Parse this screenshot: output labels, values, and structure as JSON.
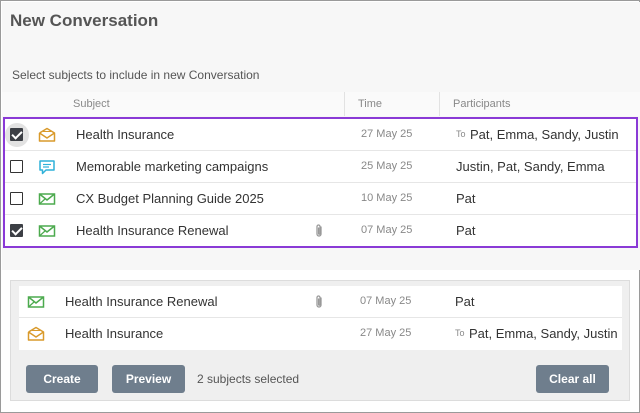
{
  "dialog": {
    "title": "New Conversation",
    "instruction": "Select subjects to include in new Conversation"
  },
  "columns": {
    "subject": "Subject",
    "time": "Time",
    "participants": "Participants"
  },
  "rows": [
    {
      "checked": true,
      "icon": "envelope-open-icon",
      "icon_color": "#d99a2b",
      "subject": "Health Insurance",
      "attachment": false,
      "time": "27 May 25",
      "to_prefix": "To",
      "participants": "Pat, Emma, Sandy, Justin"
    },
    {
      "checked": false,
      "icon": "chat-bubble-icon",
      "icon_color": "#2fb1d9",
      "subject": "Memorable marketing campaigns",
      "attachment": false,
      "time": "25 May 25",
      "to_prefix": "",
      "participants": "Justin, Pat, Sandy, Emma"
    },
    {
      "checked": false,
      "icon": "envelope-icon",
      "icon_color": "#4caa4e",
      "subject": "CX Budget Planning Guide 2025",
      "attachment": false,
      "time": "10 May 25",
      "to_prefix": "",
      "participants": "Pat"
    },
    {
      "checked": true,
      "icon": "envelope-icon",
      "icon_color": "#4caa4e",
      "subject": "Health Insurance Renewal",
      "attachment": true,
      "time": "07 May 25",
      "to_prefix": "",
      "participants": "Pat"
    }
  ],
  "selected": [
    {
      "icon": "envelope-icon",
      "icon_color": "#4caa4e",
      "subject": "Health Insurance Renewal",
      "attachment": true,
      "time": "07 May 25",
      "to_prefix": "",
      "participants": "Pat"
    },
    {
      "icon": "envelope-open-icon",
      "icon_color": "#d99a2b",
      "subject": "Health Insurance",
      "attachment": false,
      "time": "27 May 25",
      "to_prefix": "To",
      "participants": "Pat, Emma, Sandy, Justin"
    }
  ],
  "actions": {
    "create": "Create",
    "preview": "Preview",
    "status": "2 subjects selected",
    "clear_all": "Clear all"
  },
  "colors": {
    "selection_border": "#8a3ad6",
    "button_bg": "#6f7e8d"
  }
}
